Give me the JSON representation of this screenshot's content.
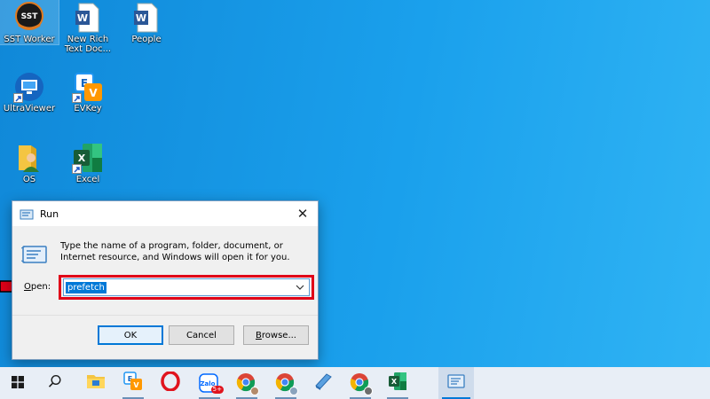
{
  "desktop": {
    "icons": [
      {
        "label": "SST Worker",
        "logo_text": "SST"
      },
      {
        "label": "New Rich Text Doc..."
      },
      {
        "label": "People"
      },
      {
        "label": "UltraViewer"
      },
      {
        "label": "EVKey"
      },
      {
        "label": "OS"
      },
      {
        "label": "Excel"
      }
    ]
  },
  "run_dialog": {
    "title": "Run",
    "close_glyph": "✕",
    "description": "Type the name of a program, folder, document, or Internet resource, and Windows will open it for you.",
    "open_label_prefix": "O",
    "open_label_rest": "pen:",
    "input_value": "prefetch",
    "buttons": {
      "ok": "OK",
      "cancel": "Cancel",
      "browse_u": "B",
      "browse_rest": "rowse..."
    },
    "highlight_color": "#e00018"
  },
  "taskbar": {
    "items": [
      {
        "icon": "windows-start-icon"
      },
      {
        "icon": "search-icon"
      },
      {
        "icon": "file-explorer-icon"
      },
      {
        "icon": "evkey-icon"
      },
      {
        "icon": "opera-icon"
      },
      {
        "icon": "zalo-icon",
        "badge": "5+"
      },
      {
        "icon": "chrome-icon"
      },
      {
        "icon": "chrome-icon"
      },
      {
        "icon": "app-icon"
      },
      {
        "icon": "chrome-icon"
      },
      {
        "icon": "excel-icon"
      },
      {
        "icon": "run-icon"
      }
    ]
  },
  "colors": {
    "desktop_blue": "#1a9be6",
    "accent": "#0078d7",
    "arrow_red": "#e00018"
  }
}
